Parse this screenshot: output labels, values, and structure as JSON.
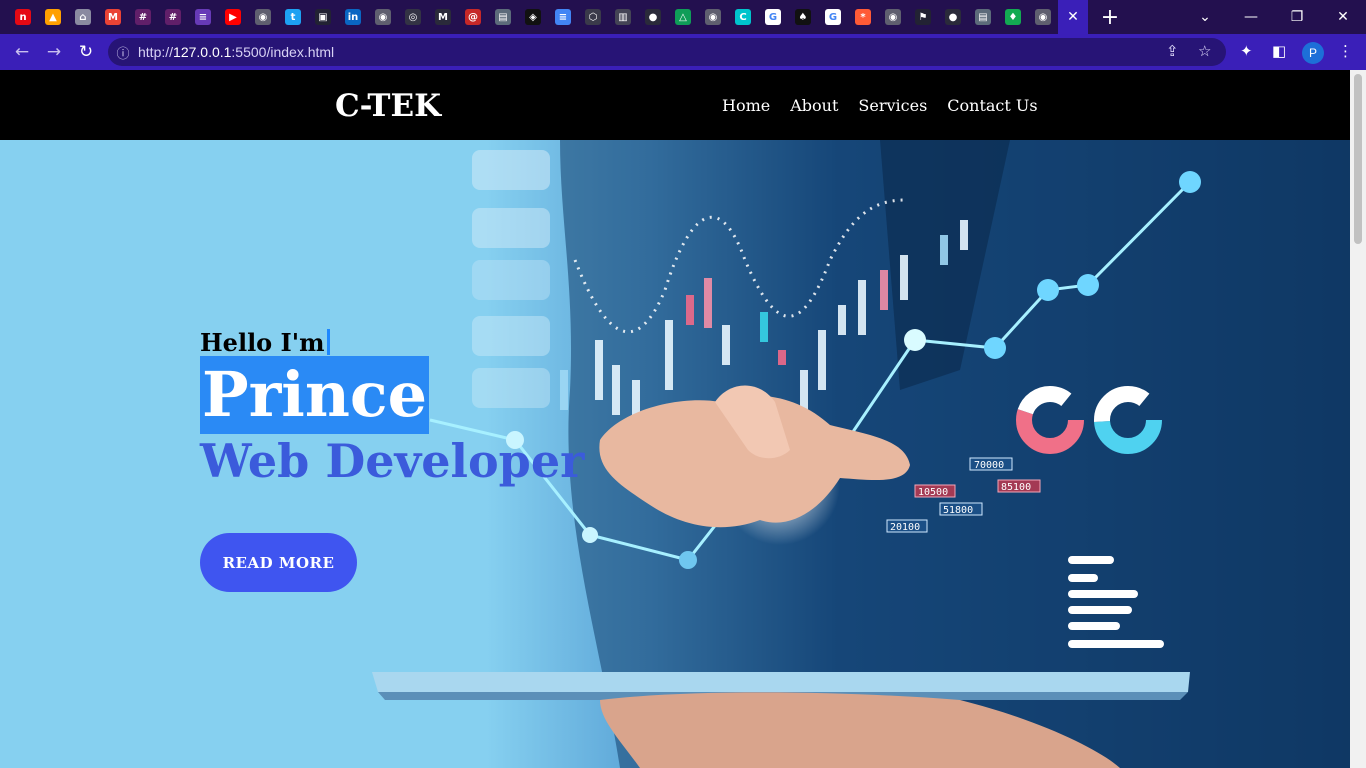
{
  "browser": {
    "tabs": [
      {
        "icon": "netflix-icon",
        "color": "#e50914",
        "glyph": "n"
      },
      {
        "icon": "firebase-icon",
        "color": "#ffa000",
        "glyph": "▲"
      },
      {
        "icon": "store-icon",
        "color": "#8a8aa0",
        "glyph": "⌂"
      },
      {
        "icon": "gmail-icon",
        "color": "#ea4335",
        "glyph": "M"
      },
      {
        "icon": "slack-icon",
        "color": "#611f69",
        "glyph": "#"
      },
      {
        "icon": "slack-icon",
        "color": "#611f69",
        "glyph": "#"
      },
      {
        "icon": "forms-icon",
        "color": "#673ab7",
        "glyph": "≡"
      },
      {
        "icon": "youtube-icon",
        "color": "#ff0000",
        "glyph": "▶"
      },
      {
        "icon": "globe-icon",
        "color": "#5f5f6f",
        "glyph": "◉"
      },
      {
        "icon": "twitter-icon",
        "color": "#1da1f2",
        "glyph": "t"
      },
      {
        "icon": "bag-icon",
        "color": "#222233",
        "glyph": "▣"
      },
      {
        "icon": "linkedin-icon",
        "color": "#0a66c2",
        "glyph": "in"
      },
      {
        "icon": "globe-icon",
        "color": "#5f5f6f",
        "glyph": "◉"
      },
      {
        "icon": "openai-icon",
        "color": "#333344",
        "glyph": "◎"
      },
      {
        "icon": "m-icon",
        "color": "#2a2a3a",
        "glyph": "M"
      },
      {
        "icon": "swirl-icon",
        "color": "#c62828",
        "glyph": "@"
      },
      {
        "icon": "store-icon",
        "color": "#5c6b7a",
        "glyph": "▤"
      },
      {
        "icon": "codepen-icon",
        "color": "#111111",
        "glyph": "◈"
      },
      {
        "icon": "docs-icon",
        "color": "#4285f4",
        "glyph": "≡"
      },
      {
        "icon": "cube-icon",
        "color": "#3a3a4a",
        "glyph": "⬡"
      },
      {
        "icon": "book-icon",
        "color": "#444455",
        "glyph": "▥"
      },
      {
        "icon": "github-icon",
        "color": "#2a2a3a",
        "glyph": "●"
      },
      {
        "icon": "drive-icon",
        "color": "#0f9d58",
        "glyph": "△"
      },
      {
        "icon": "globe-icon",
        "color": "#5f5f6f",
        "glyph": "◉"
      },
      {
        "icon": "canva-icon",
        "color": "#00c4cc",
        "glyph": "C"
      },
      {
        "icon": "google-icon",
        "color": "#ffffff",
        "glyph": "G"
      },
      {
        "icon": "spade-icon",
        "color": "#111111",
        "glyph": "♠"
      },
      {
        "icon": "google-icon",
        "color": "#ffffff",
        "glyph": "G"
      },
      {
        "icon": "asterisk-icon",
        "color": "#ff5a36",
        "glyph": "*"
      },
      {
        "icon": "globe-icon",
        "color": "#5f5f6f",
        "glyph": "◉"
      },
      {
        "icon": "flag-icon",
        "color": "#222233",
        "glyph": "⚑"
      },
      {
        "icon": "github-icon",
        "color": "#2a2a3a",
        "glyph": "●"
      },
      {
        "icon": "store-icon",
        "color": "#5c6b7a",
        "glyph": "▤"
      },
      {
        "icon": "mongodb-icon",
        "color": "#13aa52",
        "glyph": "♦"
      },
      {
        "icon": "globe-icon",
        "color": "#5f5f6f",
        "glyph": "◉"
      }
    ],
    "url_scheme": "http://",
    "url_host": "127.0.0.1",
    "url_rest": ":5500/index.html",
    "profile_initial": "P",
    "accent": "#3a1fb8"
  },
  "nav": {
    "logo": "C-TEK",
    "links": [
      "Home",
      "About",
      "Services",
      "Contact Us"
    ]
  },
  "hero": {
    "greeting": "Hello I'm",
    "name": "Prince",
    "role": "Web Developer",
    "cta": "READ MORE",
    "chart_labels": [
      "70000",
      "10500",
      "85100",
      "20100",
      "51800"
    ],
    "colors": {
      "name_highlight": "#2a8af5",
      "role": "#3b5bdb",
      "button": "#3f55f0"
    }
  }
}
